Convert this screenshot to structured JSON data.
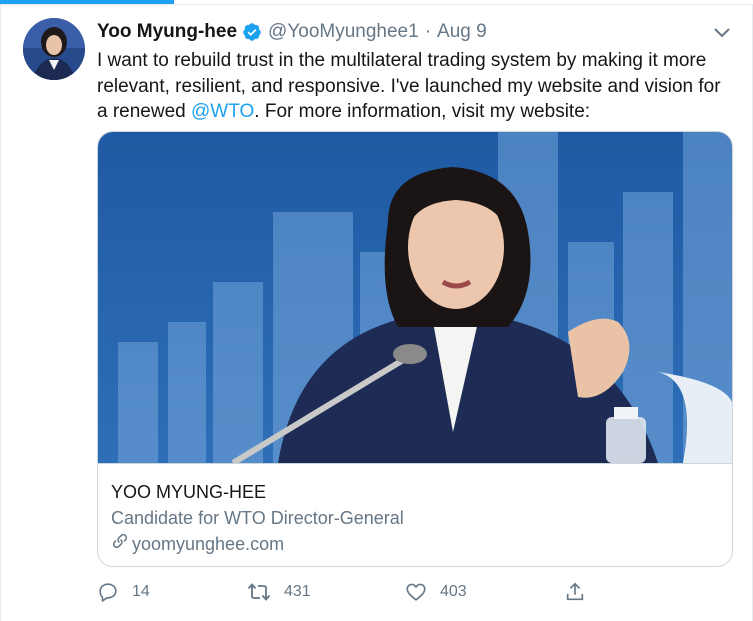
{
  "tweet": {
    "display_name": "Yoo Myung-hee",
    "handle": "@YooMyunghee1",
    "separator": "·",
    "time": "Aug 9",
    "text_before": "I want to rebuild trust in the multilateral trading system by making it more relevant, resilient, and responsive. I've launched my website and vision for a renewed ",
    "mention": "@WTO",
    "text_after": ". For more information, visit my website:"
  },
  "card": {
    "title": "YOO MYUNG-HEE",
    "description": "Candidate for WTO Director-General",
    "url": "yoomyunghee.com"
  },
  "actions": {
    "reply_count": "14",
    "retweet_count": "431",
    "like_count": "403"
  },
  "icons": {
    "verified": "verified-badge-icon",
    "caret": "chevron-down-icon",
    "reply": "reply-icon",
    "retweet": "retweet-icon",
    "like": "heart-icon",
    "share": "share-icon",
    "link": "link-icon"
  },
  "colors": {
    "accent": "#1da1f2",
    "secondary_text": "#657786",
    "border": "#ccd6dd"
  }
}
